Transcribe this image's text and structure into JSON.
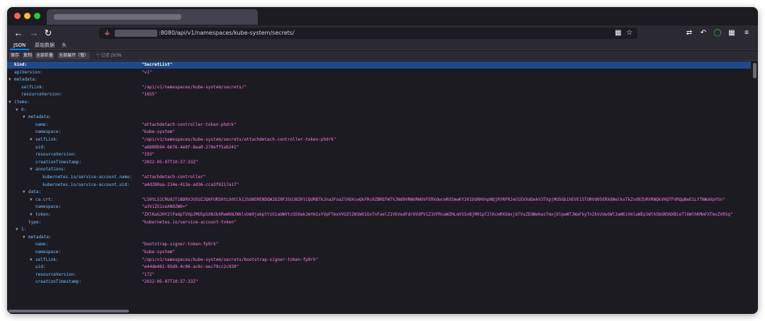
{
  "browser": {
    "url": ":8080/api/v1/namespaces/kube-system/secrets/",
    "icons": [
      "back-icon",
      "forward-icon",
      "reload-icon",
      "lock-icon",
      "qr-code-icon",
      "bookmark-star-icon",
      "extension-icon",
      "undo-icon",
      "circle-extension-icon",
      "grid-extension-icon",
      "menu-icon"
    ]
  },
  "viewer": {
    "tabs": [
      "JSON",
      "原始数据",
      "头"
    ],
    "toolbar": {
      "save": "保存",
      "copy": "复制",
      "collapse_all": "全部折叠",
      "expand_all": "全部展开（慢）",
      "filter_placeholder": "过滤 JSON"
    }
  },
  "json_rows": [
    {
      "key": "kind:",
      "value": "\"SecretList\"",
      "indent": 0,
      "twisty": "",
      "selected": true
    },
    {
      "key": "apiVersion:",
      "value": "\"v1\"",
      "indent": 0,
      "twisty": ""
    },
    {
      "key": "metadata:",
      "value": "",
      "indent": 0,
      "twisty": "▼"
    },
    {
      "key": "selfLink:",
      "value": "\"/api/v1/namespaces/kube-system/secrets/\"",
      "indent": 1,
      "twisty": ""
    },
    {
      "key": "resourceVersion:",
      "value": "\"1655\"",
      "indent": 1,
      "twisty": ""
    },
    {
      "key": "items:",
      "value": "",
      "indent": 0,
      "twisty": "▼"
    },
    {
      "key": "0:",
      "value": "",
      "indent": 1,
      "twisty": "▼"
    },
    {
      "key": "metadata:",
      "value": "",
      "indent": 2,
      "twisty": "▼"
    },
    {
      "key": "name:",
      "value": "\"attachdetach-controller-token-phdrk\"",
      "indent": 3,
      "twisty": ""
    },
    {
      "key": "namespace:",
      "value": "\"kube-system\"",
      "indent": 3,
      "twisty": ""
    },
    {
      "key": "selfLink:",
      "value": "\"/api/v1/namespaces/kube-system/secrets/attachdetach-controller-token-phdrk\"",
      "indent": 3,
      "twisty": "▼"
    },
    {
      "key": "uid:",
      "value": "\"a6889b94-6676-4e8f-8ea0-270eff5ab241\"",
      "indent": 3,
      "twisty": ""
    },
    {
      "key": "resourceVersion:",
      "value": "\"193\"",
      "indent": 3,
      "twisty": ""
    },
    {
      "key": "creationTimestamp:",
      "value": "\"2022-05-07T10:37:33Z\"",
      "indent": 3,
      "twisty": ""
    },
    {
      "key": "annotations:",
      "value": "",
      "indent": 3,
      "twisty": "▼"
    },
    {
      "key": "kubernetes.io/service-account.name:",
      "value": "\"attachdetach-controller\"",
      "indent": 4,
      "twisty": ""
    },
    {
      "key": "kubernetes.io/service-account.uid:",
      "value": "\"a4d280aa-234e-413e-ad36-cca3f6217a17\"",
      "indent": 4,
      "twisty": ""
    },
    {
      "key": "data:",
      "value": "",
      "indent": 2,
      "twisty": "▼"
    },
    {
      "key": "ca.crt:",
      "value": "\"LS0tLS1CRUdJTiBDRVJUSUZJQ0FURS0tLS0tCk1JSUN5RENDQWJDZ0F3SUJBZ0lCQURBTkJna3Foa2lHOXcwQkFRc0ZBREFWTVJNd0VRWURWUVFERXdwcmRXSmwKY201bGRHVnpNQjRYRFRJeU1EVXdOekV3TXpjMU5Gb1hEVE15TURVd05ERXdNelkxTkZvd0ZURVRNQkVHQTFVRQpBeE1LYTNWaVpYSn\"",
      "indent": 3,
      "twisty": "▼"
    },
    {
      "key": "namespace:",
      "value": "\"a3ViZS1zeXN0ZW0=\"",
      "indent": 3,
      "twisty": ""
    },
    {
      "key": "token:",
      "value": "\"ZXlKaGJHY2lPaUpTVXpJMU5pSXNJbXRwWkNJNklsUm9jakptYzG1aUWVtcG50akJmYm1sYVpFTmxVVUZtZW1WU1UxTnFaelZ1VkVwdFdrOVdPV1Z1VFRnaWZHLmV5SnBjM01pT2lKcmRXSmxjbTVsZEdWekwzTmxjblpwWTJWaFkyTnZkVzUwSWl3aWEzVmlaWEp1WlhSbGN5NXBieTl6WlhKMmFXTmxZV05q\"",
      "indent": 3,
      "twisty": "▼"
    },
    {
      "key": "type:",
      "value": "\"kubernetes.io/service-account-token\"",
      "indent": 2,
      "twisty": ""
    },
    {
      "key": "1:",
      "value": "",
      "indent": 1,
      "twisty": "▼"
    },
    {
      "key": "metadata:",
      "value": "",
      "indent": 2,
      "twisty": "▼"
    },
    {
      "key": "name:",
      "value": "\"bootstrap-signer-token-fp9rk\"",
      "indent": 3,
      "twisty": ""
    },
    {
      "key": "namespace:",
      "value": "\"kube-system\"",
      "indent": 3,
      "twisty": ""
    },
    {
      "key": "selfLink:",
      "value": "\"/api/v1/namespaces/kube-system/secrets/bootstrap-signer-token-fp9rk\"",
      "indent": 3,
      "twisty": "▼"
    },
    {
      "key": "uid:",
      "value": "\"e44de481-95d9-4c06-ac6c-eec79cc2c939\"",
      "indent": 3,
      "twisty": ""
    },
    {
      "key": "resourceVersion:",
      "value": "\"172\"",
      "indent": 3,
      "twisty": ""
    },
    {
      "key": "creationTimestamp:",
      "value": "\"2022-05-07T10:37:33Z\"",
      "indent": 3,
      "twisty": ""
    }
  ]
}
